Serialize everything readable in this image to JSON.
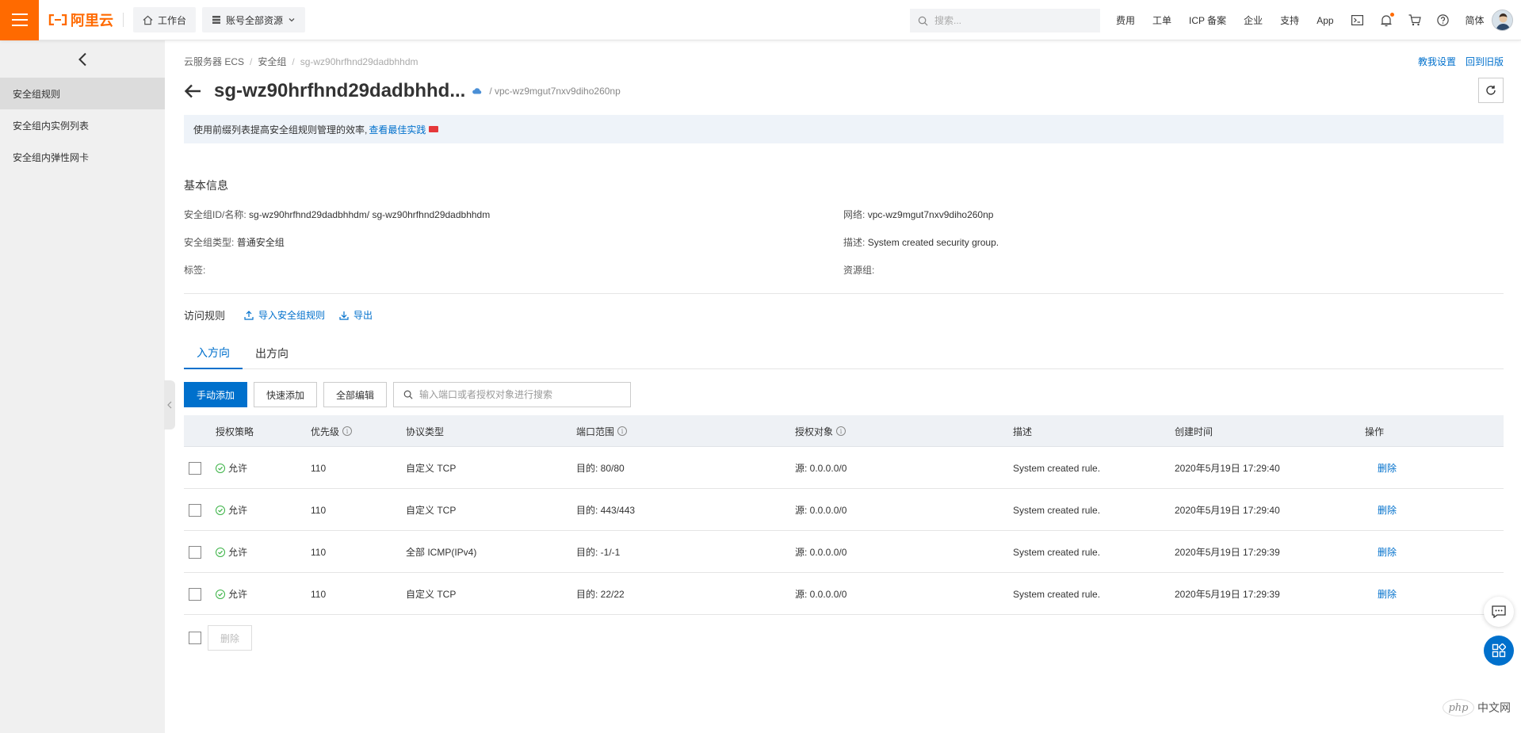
{
  "topbar": {
    "logo_text": "阿里云",
    "workbench": "工作台",
    "resources": "账号全部资源",
    "search_placeholder": "搜索...",
    "links": [
      "费用",
      "工单",
      "ICP 备案",
      "企业",
      "支持",
      "App"
    ],
    "lang": "简体"
  },
  "sidebar": {
    "items": [
      {
        "label": "安全组规则",
        "active": true
      },
      {
        "label": "安全组内实例列表",
        "active": false
      },
      {
        "label": "安全组内弹性网卡",
        "active": false
      }
    ]
  },
  "breadcrumb": {
    "items": [
      "云服务器 ECS",
      "安全组"
    ],
    "current": "sg-wz90hrfhnd29dadbhhdm"
  },
  "top_right_links": {
    "teach": "教我设置",
    "old_version": "回到旧版"
  },
  "title": {
    "text": "sg-wz90hrfhnd29dadbhhd...",
    "vpc": "/ vpc-wz9mgut7nxv9diho260np"
  },
  "notice": {
    "text": "使用前缀列表提高安全组规则管理的效率,",
    "link": "查看最佳实践"
  },
  "basic_info": {
    "title": "基本信息",
    "id_label": "安全组ID/名称:",
    "id_value": "sg-wz90hrfhnd29dadbhhdm/ sg-wz90hrfhnd29dadbhhdm",
    "type_label": "安全组类型:",
    "type_value": "普通安全组",
    "tag_label": "标签:",
    "network_label": "网络:",
    "network_value": "vpc-wz9mgut7nxv9diho260np",
    "desc_label": "描述:",
    "desc_value": "System created security group.",
    "rg_label": "资源组:"
  },
  "rules": {
    "title": "访问规则",
    "import": "导入安全组规则",
    "export": "导出"
  },
  "tabs": [
    "入方向",
    "出方向"
  ],
  "toolbar": {
    "manual_add": "手动添加",
    "quick_add": "快速添加",
    "edit_all": "全部编辑",
    "search_placeholder": "输入端口或者授权对象进行搜索"
  },
  "table": {
    "columns": [
      "授权策略",
      "优先级",
      "协议类型",
      "端口范围",
      "授权对象",
      "描述",
      "创建时间",
      "操作"
    ],
    "rows": [
      {
        "policy": "允许",
        "priority": "110",
        "protocol": "自定义 TCP",
        "port": "目的: 80/80",
        "source": "源: 0.0.0.0/0",
        "desc": "System created rule.",
        "time": "2020年5月19日 17:29:40",
        "action": "删除"
      },
      {
        "policy": "允许",
        "priority": "110",
        "protocol": "自定义 TCP",
        "port": "目的: 443/443",
        "source": "源: 0.0.0.0/0",
        "desc": "System created rule.",
        "time": "2020年5月19日 17:29:40",
        "action": "删除"
      },
      {
        "policy": "允许",
        "priority": "110",
        "protocol": "全部 ICMP(IPv4)",
        "port": "目的: -1/-1",
        "source": "源: 0.0.0.0/0",
        "desc": "System created rule.",
        "time": "2020年5月19日 17:29:39",
        "action": "删除"
      },
      {
        "policy": "允许",
        "priority": "110",
        "protocol": "自定义 TCP",
        "port": "目的: 22/22",
        "source": "源: 0.0.0.0/0",
        "desc": "System created rule.",
        "time": "2020年5月19日 17:29:39",
        "action": "删除"
      }
    ]
  },
  "footer": {
    "delete": "删除"
  },
  "watermark": {
    "logo": "php",
    "text": "中文网"
  },
  "colors": {
    "brand_orange": "#ff6a00",
    "primary_blue": "#0070cc",
    "allow_green": "#3bb346"
  }
}
